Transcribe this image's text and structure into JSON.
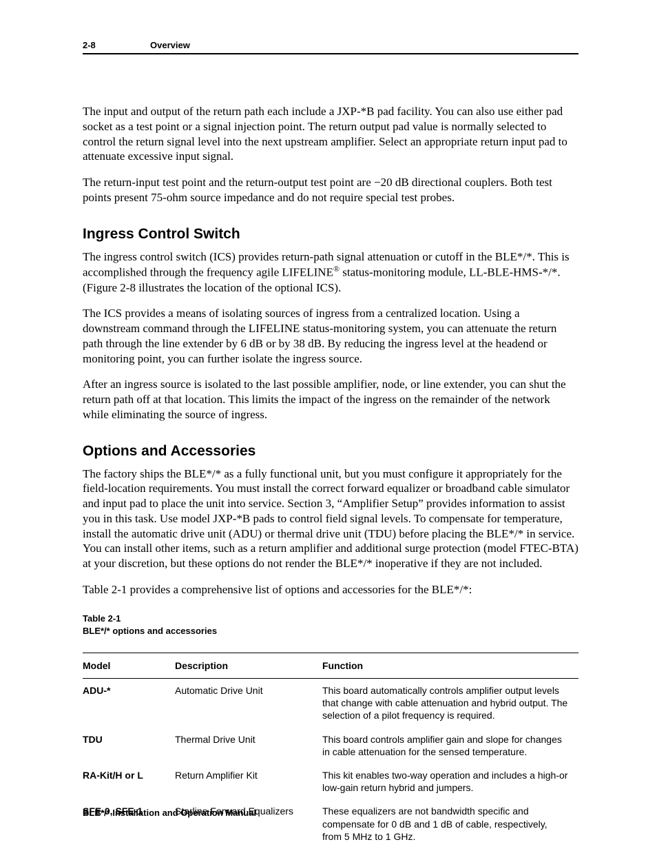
{
  "header": {
    "page_number": "2-8",
    "section": "Overview"
  },
  "paragraphs": {
    "p1": "The input and output of the return path each include a JXP-*B pad facility. You can also use either pad socket as a test point or a signal injection point. The return output pad value is normally selected to control the return signal level into the next upstream amplifier. Select an appropriate return input pad to attenuate excessive input signal.",
    "p2": "The return-input test point and the return-output test point are −20 dB directional couplers. Both test points present 75-ohm source impedance and do not require special test probes."
  },
  "ingress": {
    "heading": "Ingress Control Switch",
    "p1a": "The ingress control switch (ICS) provides return-path signal attenuation or cutoff in the BLE*/*. This is accomplished through the frequency agile LIFELINE",
    "p1b": " status-monitoring module, LL-BLE-HMS-*/*. (Figure 2-8 illustrates the location of the optional ICS).",
    "p2": "The ICS provides a means of isolating sources of ingress from a centralized location. Using a downstream command through the LIFELINE status-monitoring system, you can attenuate the return path through the line extender by 6 dB or by 38 dB. By reducing the ingress level at the headend or monitoring point, you can further isolate the ingress source.",
    "p3": "After an ingress source is isolated to the last possible amplifier, node, or line extender, you can shut the return path off at that location. This limits the impact of the ingress on the remainder of the network while eliminating the source of ingress."
  },
  "options": {
    "heading": "Options and Accessories",
    "p1": "The factory ships the BLE*/* as a fully functional unit, but you must configure it appropriately for the field-location requirements. You must install the correct forward equalizer or broadband cable simulator and input pad to place the unit into service. Section 3, “Amplifier Setup” provides information to assist you in this task. Use model JXP-*B pads to control field signal levels. To compensate for temperature, install the automatic drive unit (ADU) or thermal drive unit (TDU) before placing the BLE*/* in service. You can install other items, such as a return amplifier and additional surge protection (model FTEC-BTA) at your discretion, but these options do not render the BLE*/* inoperative if they are not included.",
    "p2": "Table 2-1 provides a comprehensive list of options and accessories for the BLE*/*:"
  },
  "table": {
    "caption_num": "Table 2-1",
    "caption_title": "BLE*/* options and accessories",
    "headers": {
      "model": "Model",
      "description": "Description",
      "function": "Function"
    },
    "rows": [
      {
        "model": "ADU-*",
        "description": "Automatic Drive Unit",
        "function": "This board automatically controls amplifier output levels that change with cable attenuation and hybrid output. The selection of a pilot frequency is required."
      },
      {
        "model": "TDU",
        "description": "Thermal Drive Unit",
        "function": "This board controls amplifier gain and slope for changes in cable attenuation for the sensed temperature."
      },
      {
        "model": "RA-Kit/H or L",
        "description": "Return Amplifier Kit",
        "function": "This kit enables two-way operation and includes a high-or low-gain return hybrid and jumpers."
      },
      {
        "model": "SFE-0, SFE-1",
        "description": "Starline Forward Equalizers",
        "function": "These equalizers are not bandwidth specific and compensate for 0 dB and 1 dB of cable, respectively, from 5 MHz to 1 GHz."
      }
    ]
  },
  "footer": "BLE*/* Installation and Operation Manual"
}
